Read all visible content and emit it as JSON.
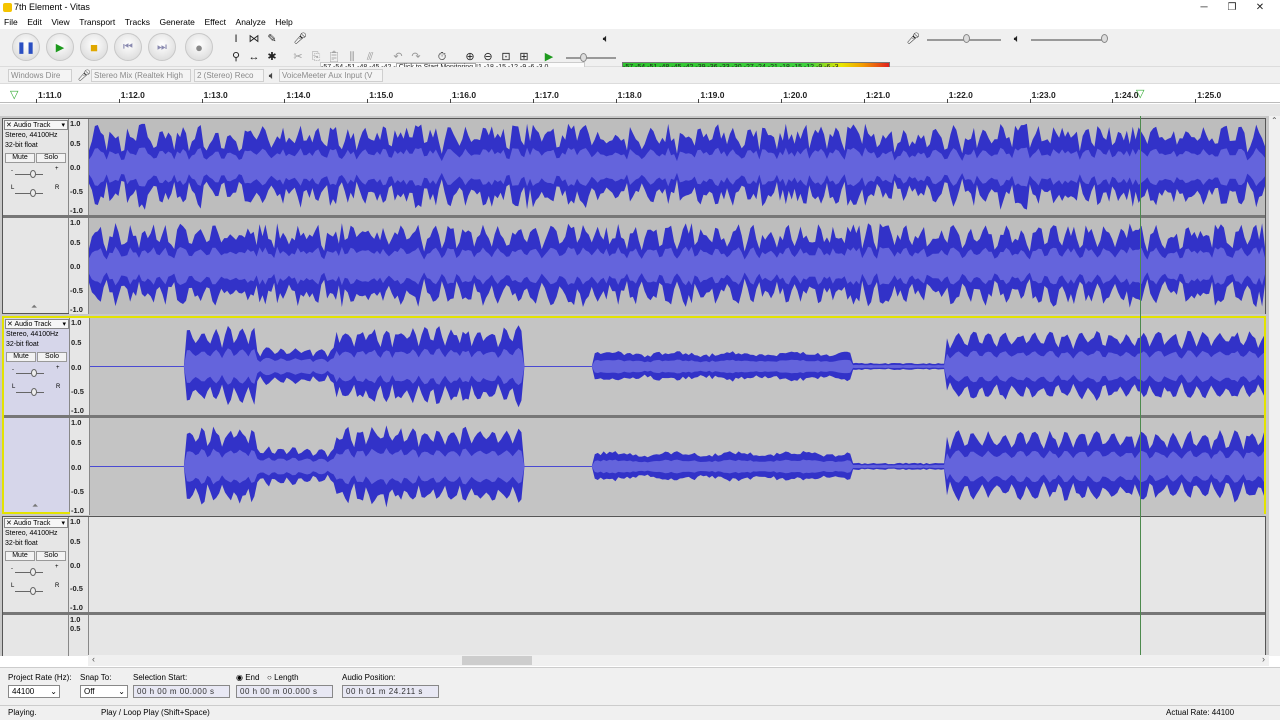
{
  "window": {
    "title": "7th Element - Vitas"
  },
  "menu": [
    "File",
    "Edit",
    "View",
    "Transport",
    "Tracks",
    "Generate",
    "Effect",
    "Analyze",
    "Help"
  ],
  "meters": {
    "record_scale": "-57 -54 -51 -48 -45 -42 -",
    "record_prompt": "Click to Start Monitoring",
    "record_scale_tail": "!1 -18 -15 -12  -9  -6  -3  0",
    "play_scale": "-57 -54 -51 -48 -45 -42 -39 -36 -33 -30 -27 -24 -21 -18 -15 -12  -9  -6  -3"
  },
  "devices": {
    "host": "Windows Dire",
    "recording_device": "Stereo Mix (Realtek High",
    "channels": "2 (Stereo) Reco",
    "playback_device": "VoiceMeeter Aux Input (V"
  },
  "ruler_ticks": [
    "1:11.0",
    "1:12.0",
    "1:13.0",
    "1:14.0",
    "1:15.0",
    "1:16.0",
    "1:17.0",
    "1:18.0",
    "1:19.0",
    "1:20.0",
    "1:21.0",
    "1:22.0",
    "1:23.0",
    "1:24.0",
    "1:25.0"
  ],
  "tracks": [
    {
      "name": "Audio Track",
      "format": "Stereo, 44100Hz",
      "depth": "32-bit float",
      "mute": "Mute",
      "solo": "Solo",
      "selected": false
    },
    {
      "name": "Audio Track",
      "format": "Stereo, 44100Hz",
      "depth": "32-bit float",
      "mute": "Mute",
      "solo": "Solo",
      "selected": true
    },
    {
      "name": "Audio Track",
      "format": "Stereo, 44100Hz",
      "depth": "32-bit float",
      "mute": "Mute",
      "solo": "Solo",
      "selected": false
    }
  ],
  "vruler": {
    "top": "1.0",
    "half": "0.5",
    "zero": "0.0",
    "neg_half": "-0.5",
    "bottom": "-1.0"
  },
  "selection_toolbar": {
    "project_rate_label": "Project Rate (Hz):",
    "project_rate": "44100",
    "snap_label": "Snap To:",
    "snap_value": "Off",
    "selection_start_label": "Selection Start:",
    "end_label": "End",
    "length_label": "Length",
    "audio_position_label": "Audio Position:",
    "selection_start": "00 h 00 m 00.000 s",
    "selection_end": "00 h 00 m 00.000 s",
    "audio_position": "00 h 01 m 24.211 s"
  },
  "status": {
    "state": "Playing.",
    "hint": "Play / Loop Play (Shift+Space)",
    "actual_rate": "Actual Rate: 44100"
  }
}
